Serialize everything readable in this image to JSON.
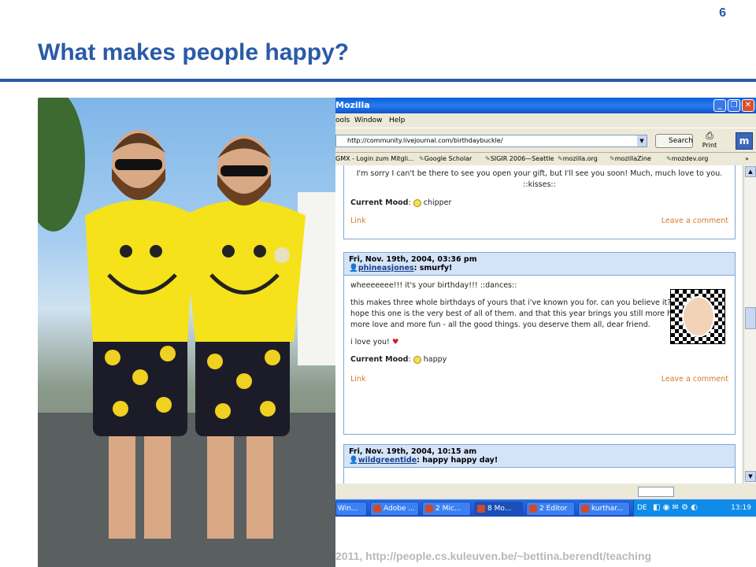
{
  "slide": {
    "number": "6",
    "title": "What makes people happy?",
    "footer": "2011, http://people.cs.kuleuven.be/~bettina.berendt/teaching"
  },
  "browser": {
    "title": "Mozilla",
    "menu": [
      "ools",
      "Window",
      "Help"
    ],
    "url": "http://community.livejournal.com/birthdaybuckle/",
    "search_label": "Search",
    "print_label": "Print",
    "bookmarks": [
      "GMX - Login zum Mitgli...",
      "Google Scholar",
      "SIGIR 2006—Seattle",
      "mozilla.org",
      "mozillaZine",
      "mozdev.org"
    ],
    "bookmarks_more": "»"
  },
  "entries": [
    {
      "text": "I'm sorry I can't be there to see you open your gift, but I'll see you soon! Much, much love to you. ::kisses::",
      "mood_label": "Current Mood",
      "mood": "chipper",
      "link": "Link",
      "comment": "Leave a comment"
    },
    {
      "date": "Fri, Nov. 19th, 2004, 03:36 pm",
      "user": "phineasjones",
      "subject": ": smurfy!",
      "p1": "wheeeeeee!!! it's your birthday!!! ::dances::",
      "p2": "this makes three whole birthdays of yours that i've known you for. can you believe it? wacky. i truly hope this one is the very best of all of them. and that this year brings you still more happiness and more love and more fun - all the good things. you deserve them all, dear friend.",
      "p3": "i love you!",
      "heart": "♥",
      "mood_label": "Current Mood",
      "mood": "happy",
      "link": "Link",
      "comment": "Leave a comment"
    },
    {
      "date": "Fri, Nov. 19th, 2004, 10:15 am",
      "user": "wildgreentide",
      "subject": ": happy happy day!"
    }
  ],
  "taskbar": {
    "items": [
      "Win...",
      "Adobe ...",
      "2 Mic...",
      "8 Mo...",
      "2 Editor",
      "kurthar..."
    ],
    "lang": "DE",
    "clock": "13:19"
  },
  "colors": {
    "title_blue": "#2a5aa8",
    "footer_gray": "#b9b9b9",
    "link_orange": "#d47a2a",
    "entry_header": "#d4e4f8"
  }
}
